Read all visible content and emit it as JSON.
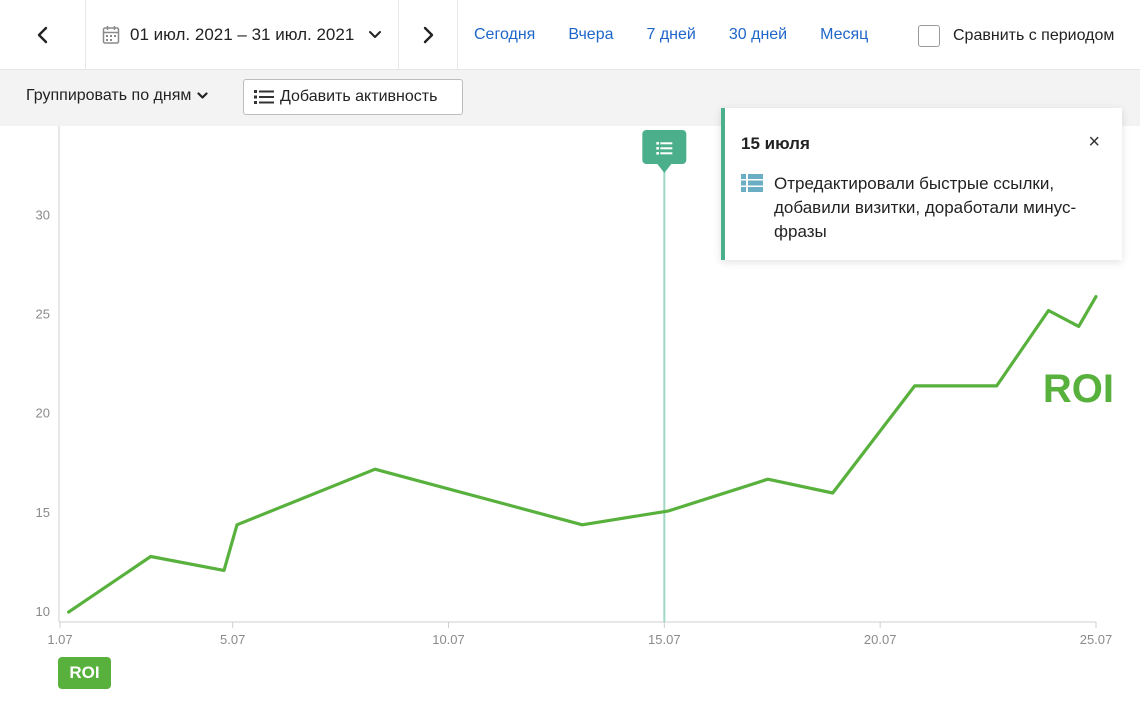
{
  "toolbar": {
    "date_range": "01 июл. 2021 – 31 июл. 2021",
    "quick_periods": [
      "Сегодня",
      "Вчера",
      "7 дней",
      "30 дней",
      "Месяц"
    ],
    "compare_label": "Сравнить с периодом",
    "compare_checked": false
  },
  "subbar": {
    "group_by": "Группировать по дням",
    "add_activity": "Добавить активность"
  },
  "tooltip": {
    "date": "15 июля",
    "text": "Отредактировали быстрые ссылки, добавили визитки, доработали минус-фразы",
    "close": "×"
  },
  "colors": {
    "series": "#59b13d",
    "marker": "#4caf8c",
    "link": "#1f66c9"
  },
  "chart_data": {
    "type": "line",
    "title": "",
    "xlabel": "",
    "ylabel": "",
    "x_ticks": [
      1,
      5,
      10,
      15,
      20,
      25
    ],
    "x_tick_labels": [
      "1.07",
      "5.07",
      "10.07",
      "15.07",
      "20.07",
      "25.07"
    ],
    "y_ticks": [
      10,
      15,
      20,
      25,
      30
    ],
    "y_tick_labels": [
      "10",
      "15",
      "20",
      "25",
      "30"
    ],
    "xlim": [
      1,
      25
    ],
    "ylim": [
      9.5,
      34.5
    ],
    "grid": false,
    "series": [
      {
        "name": "ROI",
        "x": [
          1.2,
          3.1,
          4.8,
          5.1,
          8.3,
          13.1,
          15.1,
          17.4,
          18.9,
          20.8,
          22.7,
          23.9,
          24.6,
          25.0
        ],
        "y": [
          10.0,
          12.8,
          12.1,
          14.4,
          17.2,
          14.4,
          15.1,
          16.7,
          16.0,
          21.4,
          21.4,
          25.2,
          24.4,
          25.9
        ]
      }
    ],
    "series_label": "ROI",
    "legend": [
      {
        "name": "ROI",
        "color": "#59b13d"
      }
    ],
    "legend_position": "bottom-left",
    "activity_marker": {
      "x": 15
    }
  }
}
